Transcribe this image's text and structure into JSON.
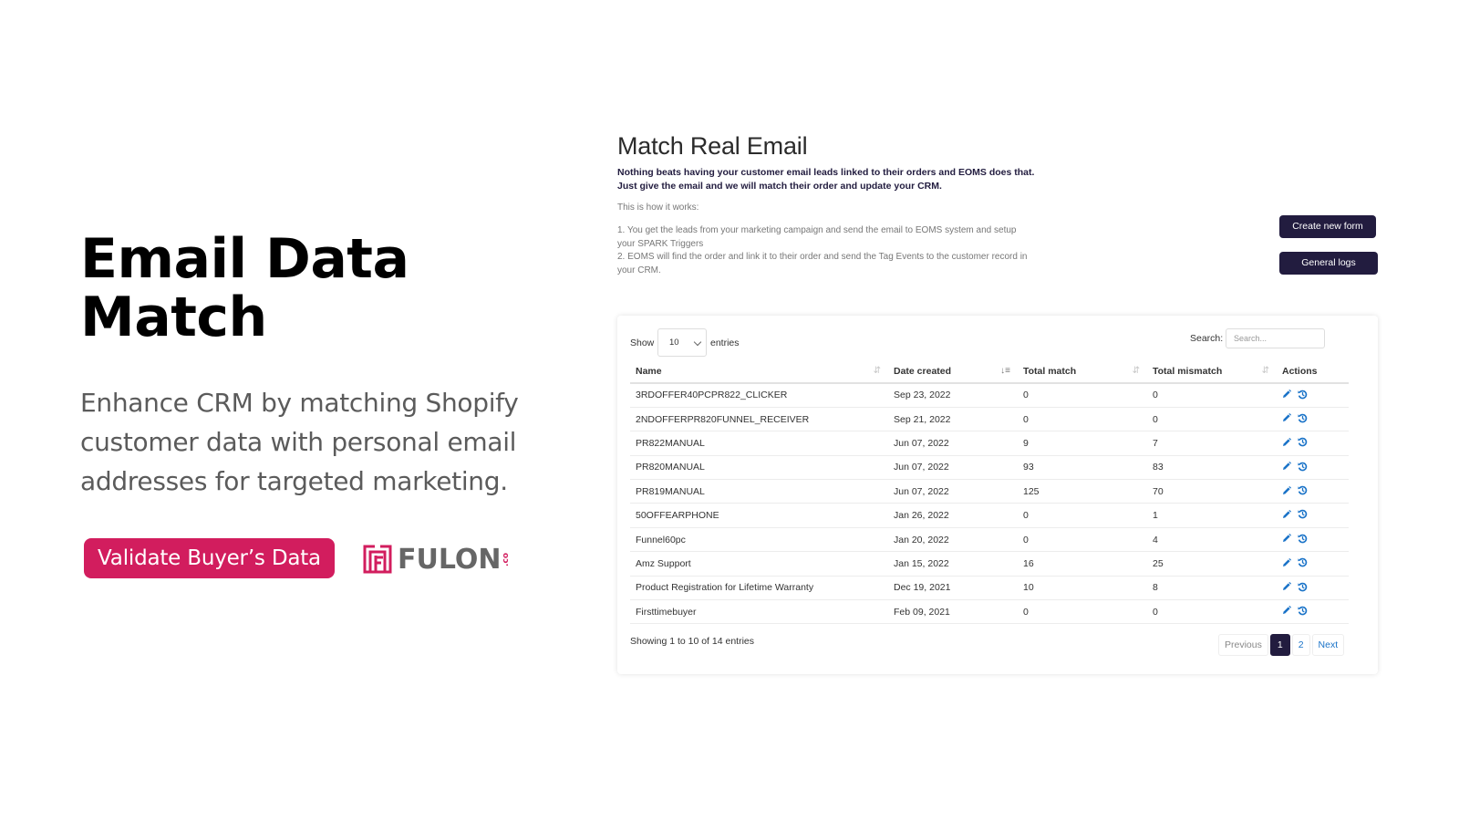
{
  "hero": {
    "title": "Email Data Match",
    "description": "Enhance CRM by matching Shopify customer data with personal email addresses for targeted marketing.",
    "cta_label": "Validate Buyer’s Data",
    "brand_name": "FULON",
    "brand_suffix": ".co"
  },
  "colors": {
    "accent_pink": "#d21d5e",
    "dark_navy": "#221c3f",
    "link_blue": "#1a73c8"
  },
  "app": {
    "title": "Match Real Email",
    "lead": "Nothing beats having your customer email leads linked to their orders and EOMS does that. Just give the email and we will match their order and update your CRM.",
    "how_label": "This is how it works:",
    "steps": [
      "1. You get the leads from your marketing campaign and send the email to EOMS system and setup your SPARK Triggers",
      "2. EOMS will find the order and link it to their order and send the Tag Events to the customer record in your CRM."
    ],
    "buttons": {
      "create": "Create new form",
      "logs": "General logs"
    },
    "table_controls": {
      "show_label": "Show",
      "page_length": "10",
      "entries_label": "entries",
      "search_label": "Search:",
      "search_placeholder": "Search...",
      "search_value": ""
    },
    "columns": [
      "Name",
      "Date created",
      "Total match",
      "Total mismatch",
      "Actions"
    ],
    "sort": {
      "active_column": "Date created",
      "direction": "descending"
    },
    "rows": [
      {
        "name": "3RDOFFER40PCPR822_CLICKER",
        "date": "Sep 23, 2022",
        "match": "0",
        "mismatch": "0"
      },
      {
        "name": "2NDOFFERPR820FUNNEL_RECEIVER",
        "date": "Sep 21, 2022",
        "match": "0",
        "mismatch": "0"
      },
      {
        "name": "PR822MANUAL",
        "date": "Jun 07, 2022",
        "match": "9",
        "mismatch": "7"
      },
      {
        "name": "PR820MANUAL",
        "date": "Jun 07, 2022",
        "match": "93",
        "mismatch": "83"
      },
      {
        "name": "PR819MANUAL",
        "date": "Jun 07, 2022",
        "match": "125",
        "mismatch": "70"
      },
      {
        "name": "50OFFEARPHONE",
        "date": "Jan 26, 2022",
        "match": "0",
        "mismatch": "1"
      },
      {
        "name": "Funnel60pc",
        "date": "Jan 20, 2022",
        "match": "0",
        "mismatch": "4"
      },
      {
        "name": "Amz Support",
        "date": "Jan 15, 2022",
        "match": "16",
        "mismatch": "25"
      },
      {
        "name": "Product Registration for Lifetime Warranty",
        "date": "Dec 19, 2021",
        "match": "10",
        "mismatch": "8"
      },
      {
        "name": "Firsttimebuyer",
        "date": "Feb 09, 2021",
        "match": "0",
        "mismatch": "0"
      }
    ],
    "row_action_icons": [
      "pencil-icon",
      "history-icon"
    ],
    "info": "Showing 1 to 10 of 14 entries",
    "pagination": {
      "previous": "Previous",
      "pages": [
        "1",
        "2"
      ],
      "current": "1",
      "next": "Next"
    }
  }
}
